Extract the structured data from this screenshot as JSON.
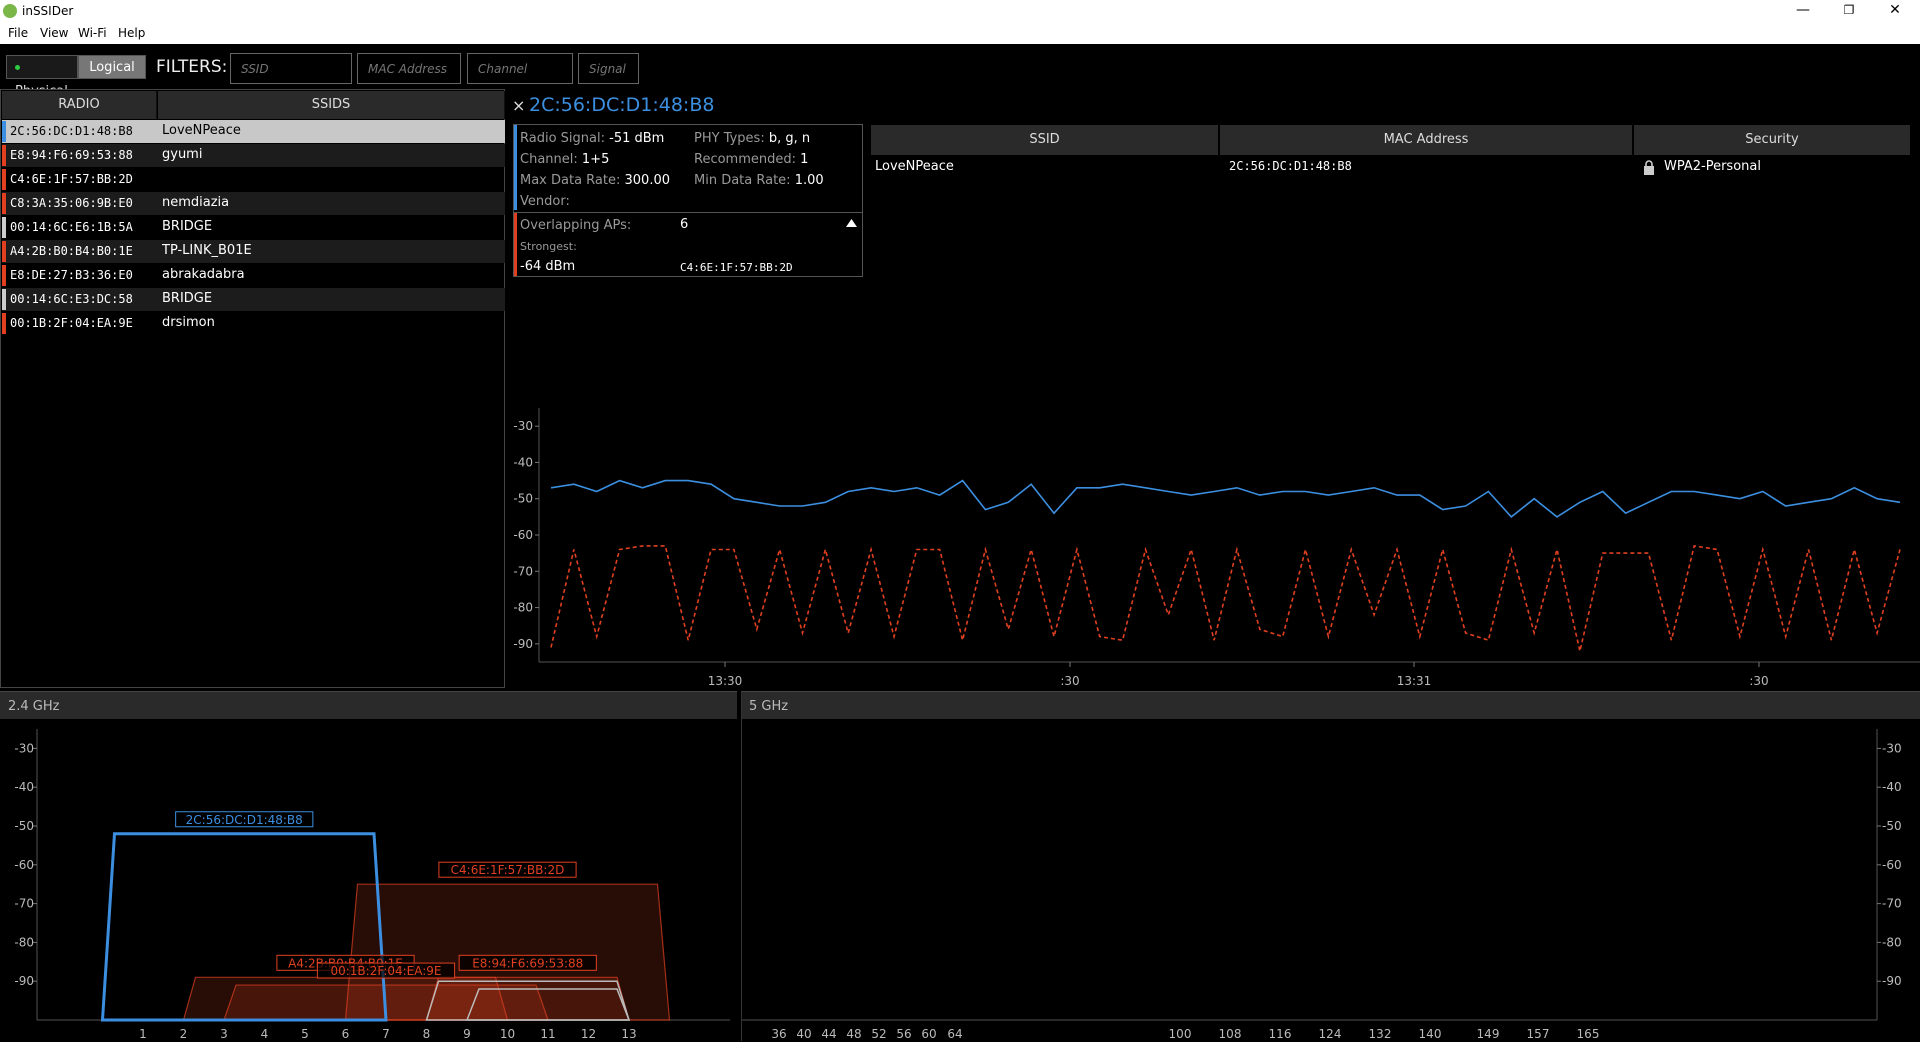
{
  "window": {
    "title": "inSSIDer",
    "minimize": "—",
    "maximize": "❐",
    "close": "✕"
  },
  "menu": [
    "File",
    "View",
    "Wi-Fi",
    "Help"
  ],
  "toolbar": {
    "physical_label": "Physical",
    "logical_label": "Logical",
    "filters_label": "FILTERS:",
    "filter_placeholders": [
      "SSID",
      "MAC Address",
      "Channel",
      "Signal"
    ]
  },
  "radio_list": {
    "headers": [
      "RADIO",
      "SSIDS"
    ],
    "rows": [
      {
        "mac": "2C:56:DC:D1:48:B8",
        "ssid": "LoveNPeace",
        "color": "#3c8fe0"
      },
      {
        "mac": "E8:94:F6:69:53:88",
        "ssid": "gyumi",
        "color": "#e04020"
      },
      {
        "mac": "C4:6E:1F:57:BB:2D",
        "ssid": "",
        "color": "#e04020"
      },
      {
        "mac": "C8:3A:35:06:9B:E0",
        "ssid": "nemdiazia",
        "color": "#e04020"
      },
      {
        "mac": "00:14:6C:E6:1B:5A",
        "ssid": "BRIDGE",
        "color": "#cccccc"
      },
      {
        "mac": "A4:2B:B0:B4:B0:1E",
        "ssid": "TP-LINK_B01E",
        "color": "#e04020"
      },
      {
        "mac": "E8:DE:27:B3:36:E0",
        "ssid": "abrakadabra",
        "color": "#e04020"
      },
      {
        "mac": "00:14:6C:E3:DC:58",
        "ssid": "BRIDGE",
        "color": "#cccccc"
      },
      {
        "mac": "00:1B:2F:04:EA:9E",
        "ssid": "drsimon",
        "color": "#e04020"
      }
    ]
  },
  "detail": {
    "close_icon": "×",
    "title": "2C:56:DC:D1:48:B8",
    "radio_signal_label": "Radio Signal:",
    "radio_signal": "-51 dBm",
    "phy_label": "PHY Types:",
    "phy": "b, g, n",
    "channel_label": "Channel:",
    "channel": "1+5",
    "recommended_label": "Recommended:",
    "recommended": "1",
    "max_rate_label": "Max Data Rate:",
    "max_rate": "300.00",
    "min_rate_label": "Min Data Rate:",
    "min_rate": "1.00",
    "vendor_label": "Vendor:",
    "overlap_label": "Overlapping APs:",
    "overlap": "6",
    "strongest_label": "Strongest:",
    "strongest_signal": "-64 dBm",
    "strongest_mac": "C4:6E:1F:57:BB:2D"
  },
  "assoc_table": {
    "headers": [
      "SSID",
      "MAC Address",
      "Security"
    ],
    "row": {
      "ssid": "LoveNPeace",
      "mac": "2C:56:DC:D1:48:B8",
      "security": "WPA2-Personal"
    }
  },
  "time_chart": {
    "y_ticks": [
      "-30",
      "-40",
      "-50",
      "-60",
      "-70",
      "-80",
      "-90"
    ],
    "x_ticks": [
      "13:30",
      ":30",
      "13:31",
      ":30"
    ],
    "ylim": [
      -95,
      -25
    ],
    "series": [
      {
        "color": "#3c8fe0",
        "dashed": false,
        "values": [
          -47,
          -46,
          -48,
          -45,
          -47,
          -45,
          -45,
          -46,
          -50,
          -51,
          -52,
          -52,
          -51,
          -48,
          -47,
          -48,
          -47,
          -49,
          -45,
          -53,
          -51,
          -46,
          -54,
          -47,
          -47,
          -46,
          -47,
          -48,
          -49,
          -48,
          -47,
          -49,
          -48,
          -48,
          -49,
          -48,
          -47,
          -49,
          -49,
          -53,
          -52,
          -48,
          -55,
          -50,
          -55,
          -51,
          -48,
          -54,
          -51,
          -48,
          -48,
          -49,
          -50,
          -48,
          -52,
          -51,
          -50,
          -47,
          -50,
          -51
        ]
      },
      {
        "color": "#e04020",
        "dashed": true,
        "values": [
          -91,
          -64,
          -88,
          -64,
          -63,
          -63,
          -89,
          -64,
          -64,
          -86,
          -64,
          -87,
          -64,
          -87,
          -64,
          -88,
          -64,
          -64,
          -89,
          -64,
          -86,
          -64,
          -88,
          -64,
          -88,
          -89,
          -64,
          -82,
          -64,
          -89,
          -64,
          -86,
          -88,
          -64,
          -88,
          -64,
          -82,
          -64,
          -88,
          -64,
          -87,
          -89,
          -64,
          -87,
          -64,
          -92,
          -65,
          -65,
          -65,
          -89,
          -63,
          -64,
          -88,
          -64,
          -88,
          -64,
          -89,
          -64,
          -87,
          -64
        ]
      }
    ]
  },
  "band24": {
    "label": "2.4 GHz",
    "y_ticks": [
      "-30",
      "-40",
      "-50",
      "-60",
      "-70",
      "-80",
      "-90"
    ],
    "x_ticks": [
      "1",
      "2",
      "3",
      "4",
      "5",
      "6",
      "7",
      "8",
      "9",
      "10",
      "11",
      "12",
      "13"
    ],
    "ylim": [
      -100,
      -25
    ],
    "networks": [
      {
        "label": "2C:56:DC:D1:48:B8",
        "color": "#3c8fe0",
        "ch_from": 0,
        "ch_to": 7,
        "signal": -52,
        "filled": false
      },
      {
        "label": "C4:6E:1F:57:BB:2D",
        "color": "#e04020",
        "ch_from": 6,
        "ch_to": 14,
        "signal": -65,
        "filled": true
      },
      {
        "label": "A4:2B:B0:B4:B0:1E",
        "color": "#e04020",
        "ch_from": 2,
        "ch_to": 10,
        "signal": -89,
        "filled": true
      },
      {
        "label": "00:1B:2F:04:EA:9E",
        "color": "#e04020",
        "ch_from": 3,
        "ch_to": 11,
        "signal": -91,
        "filled": true
      },
      {
        "label": "E8:94:F6:69:53:88",
        "color": "#e04020",
        "ch_from": 8,
        "ch_to": 13,
        "signal": -89,
        "filled": true
      },
      {
        "label": "",
        "color": "#bbbbbb",
        "ch_from": 8,
        "ch_to": 13,
        "signal": -90,
        "filled": false
      },
      {
        "label": "",
        "color": "#bbbbbb",
        "ch_from": 9,
        "ch_to": 13,
        "signal": -92,
        "filled": false
      }
    ]
  },
  "band5": {
    "label": "5 GHz",
    "y_ticks": [
      "-30",
      "-40",
      "-50",
      "-60",
      "-70",
      "-80",
      "-90"
    ],
    "x_ticks": [
      "36",
      "40",
      "44",
      "48",
      "52",
      "56",
      "60",
      "64",
      "100",
      "108",
      "116",
      "124",
      "132",
      "140",
      "149",
      "157",
      "165"
    ]
  },
  "icons": {
    "lock": "lock-icon",
    "collapse": "triangle-up-icon"
  }
}
